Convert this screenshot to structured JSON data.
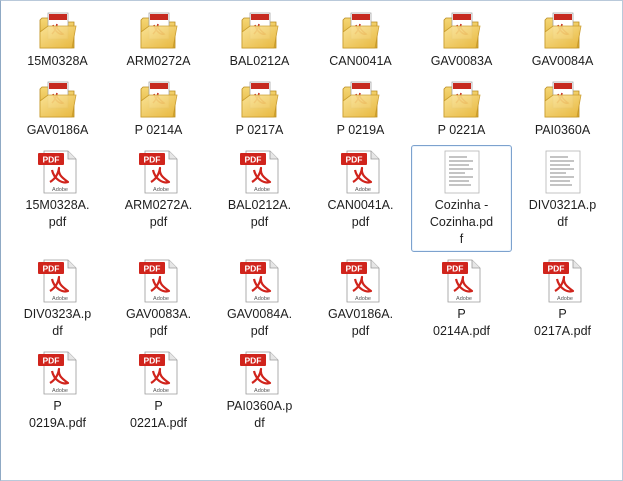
{
  "window": {
    "folders": [
      {
        "name": "15M0328A"
      },
      {
        "name": "ARM0272A"
      },
      {
        "name": "BAL0212A"
      },
      {
        "name": "CAN0041A"
      },
      {
        "name": "GAV0083A"
      },
      {
        "name": "GAV0084A"
      },
      {
        "name": "GAV0186A"
      },
      {
        "name": "P 0214A"
      },
      {
        "name": "P 0217A"
      },
      {
        "name": "P 0219A"
      },
      {
        "name": "P 0221A"
      },
      {
        "name": "PAI0360A"
      }
    ],
    "files": [
      {
        "lines": [
          "15M0328A.",
          "pdf"
        ],
        "icon": "pdf-file-icon",
        "selected": false
      },
      {
        "lines": [
          "ARM0272A.",
          "pdf"
        ],
        "icon": "pdf-file-icon",
        "selected": false
      },
      {
        "lines": [
          "BAL0212A.",
          "pdf"
        ],
        "icon": "pdf-file-icon",
        "selected": false
      },
      {
        "lines": [
          "CAN0041A.",
          "pdf"
        ],
        "icon": "pdf-file-icon",
        "selected": false
      },
      {
        "lines": [
          "Cozinha -",
          "Cozinha.pd",
          "f"
        ],
        "icon": "pdf-thumbnail-icon",
        "selected": true
      },
      {
        "lines": [
          "DIV0321A.p",
          "df"
        ],
        "icon": "pdf-thumbnail-icon",
        "selected": false
      },
      {
        "lines": [
          "DIV0323A.p",
          "df"
        ],
        "icon": "pdf-file-icon",
        "selected": false
      },
      {
        "lines": [
          "GAV0083A.",
          "pdf"
        ],
        "icon": "pdf-file-icon",
        "selected": false
      },
      {
        "lines": [
          "GAV0084A.",
          "pdf"
        ],
        "icon": "pdf-file-icon",
        "selected": false
      },
      {
        "lines": [
          "GAV0186A.",
          "pdf"
        ],
        "icon": "pdf-file-icon",
        "selected": false
      },
      {
        "lines": [
          "P",
          "0214A.pdf"
        ],
        "icon": "pdf-file-icon",
        "selected": false
      },
      {
        "lines": [
          "P",
          "0217A.pdf"
        ],
        "icon": "pdf-file-icon",
        "selected": false
      },
      {
        "lines": [
          "P",
          "0219A.pdf"
        ],
        "icon": "pdf-file-icon",
        "selected": false
      },
      {
        "lines": [
          "P",
          "0221A.pdf"
        ],
        "icon": "pdf-file-icon",
        "selected": false
      },
      {
        "lines": [
          "PAI0360A.p",
          "df"
        ],
        "icon": "pdf-file-icon",
        "selected": false
      }
    ],
    "icon_labels": {
      "pdf_badge": "PDF",
      "adobe_text": "Adobe"
    },
    "colors": {
      "selection_border": "#7da2ce",
      "pdf_red": "#d0241c",
      "folder_yellow": "#f1c84a"
    }
  }
}
